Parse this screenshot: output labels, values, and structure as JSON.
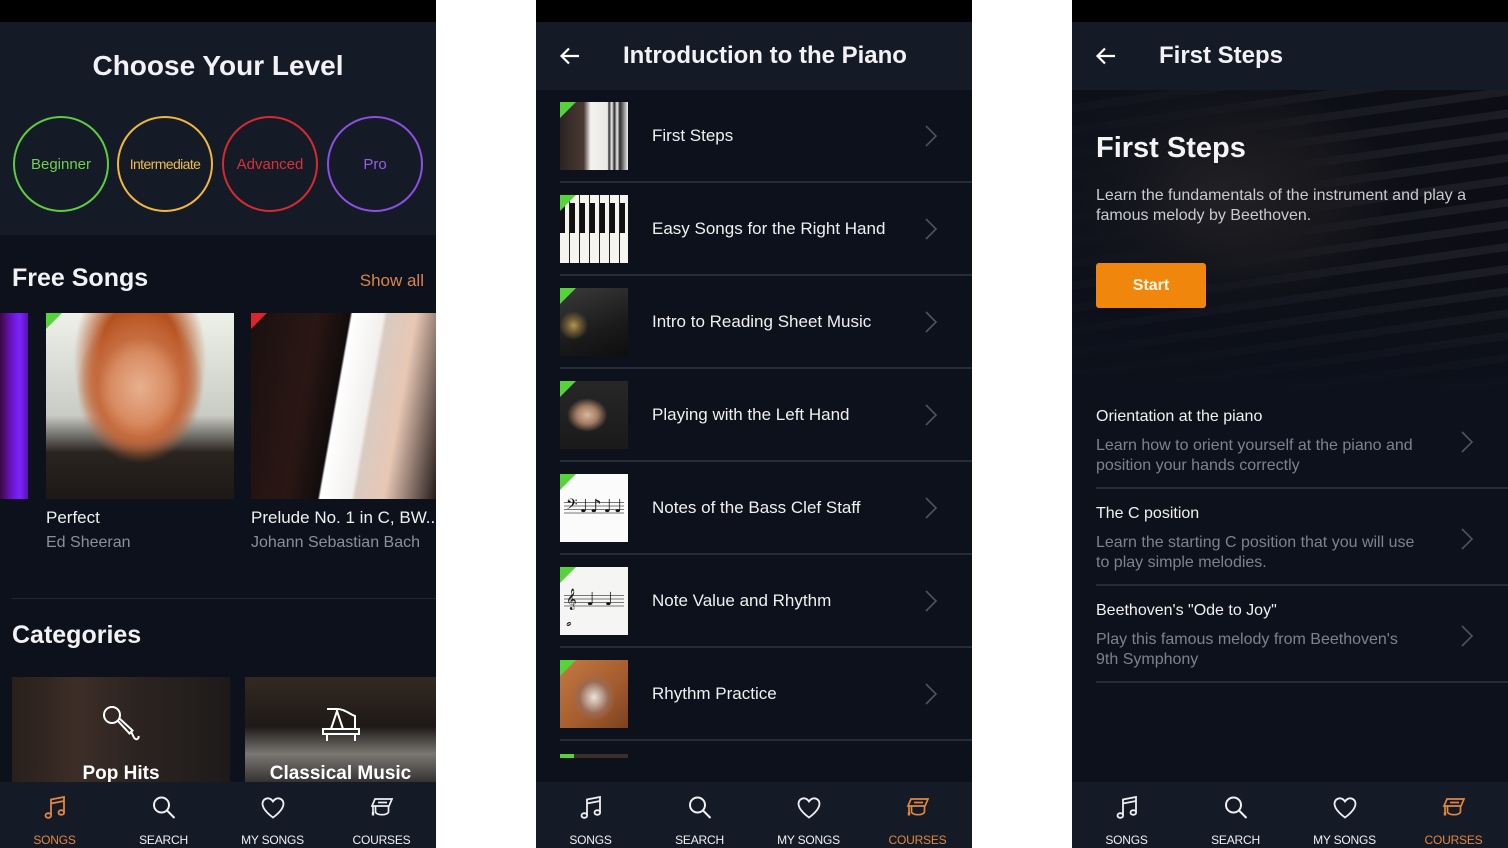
{
  "colors": {
    "accent": "#e0873d",
    "start_button": "#f0860b",
    "beginner": "#5dcc3d",
    "intermediate": "#f0b73a",
    "advanced": "#d72a2f",
    "pro": "#8d4fe0",
    "completed_flag": "#57d33a",
    "background": "#0d111b",
    "bar": "#151a27"
  },
  "nav": {
    "items": [
      {
        "label": "SONGS",
        "icon": "music-note-icon"
      },
      {
        "label": "SEARCH",
        "icon": "search-icon"
      },
      {
        "label": "MY SONGS",
        "icon": "heart-icon"
      },
      {
        "label": "COURSES",
        "icon": "courses-icon"
      }
    ]
  },
  "screen1": {
    "title": "Choose Your Level",
    "levels": [
      "Beginner",
      "Intermediate",
      "Advanced",
      "Pro"
    ],
    "free_songs": {
      "heading": "Free Songs",
      "show_all": "Show all",
      "songs": [
        {
          "title": "Perfect",
          "artist": "Ed Sheeran",
          "flag": "green"
        },
        {
          "title": "Prelude No. 1 in C, BW...",
          "artist": "Johann Sebastian Bach",
          "flag": "red"
        }
      ]
    },
    "categories": {
      "heading": "Categories",
      "items": [
        {
          "label": "Pop Hits",
          "icon": "microphone-icon"
        },
        {
          "label": "Classical Music",
          "icon": "grand-piano-icon"
        }
      ]
    },
    "active_tab": "SONGS"
  },
  "screen2": {
    "title": "Introduction to the Piano",
    "lessons": [
      {
        "title": "First Steps"
      },
      {
        "title": "Easy Songs for the Right Hand"
      },
      {
        "title": "Intro to Reading Sheet Music"
      },
      {
        "title": "Playing with the Left Hand"
      },
      {
        "title": "Notes of the Bass Clef Staff"
      },
      {
        "title": "Note Value and Rhythm"
      },
      {
        "title": "Rhythm Practice"
      }
    ],
    "next_lesson_progress": 0.2,
    "active_tab": "COURSES"
  },
  "screen3": {
    "title": "First Steps",
    "hero": {
      "title": "First Steps",
      "description": "Learn the fundamentals of the instrument and play a famous melody by Beethoven.",
      "start_label": "Start"
    },
    "steps": [
      {
        "title": "Orientation at the piano",
        "description": "Learn how to orient yourself at the piano and position your hands correctly"
      },
      {
        "title": "The C position",
        "description": "Learn the starting C position that you will use to play simple melodies."
      },
      {
        "title": "Beethoven's \"Ode to Joy\"",
        "description": "Play this famous melody from Beethoven's 9th Symphony"
      }
    ],
    "active_tab": "COURSES"
  }
}
